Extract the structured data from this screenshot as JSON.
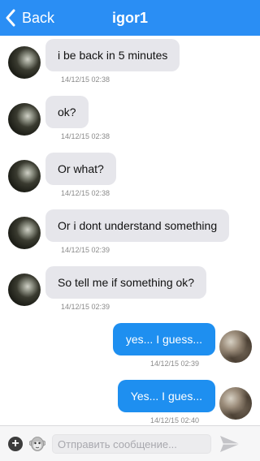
{
  "header": {
    "back_label": "Back",
    "title": "igor1"
  },
  "messages": [
    {
      "direction": "incoming",
      "text": "i be back in 5 minutes",
      "time": "14/12/15 02:38"
    },
    {
      "direction": "incoming",
      "text": "ok?",
      "time": "14/12/15 02:38"
    },
    {
      "direction": "incoming",
      "text": "Or what?",
      "time": "14/12/15 02:38"
    },
    {
      "direction": "incoming",
      "text": "Or i dont understand something",
      "time": "14/12/15 02:39"
    },
    {
      "direction": "incoming",
      "text": "So tell me if something ok?",
      "time": "14/12/15 02:39"
    },
    {
      "direction": "outgoing",
      "text": "yes... I guess...",
      "time": "14/12/15 02:39"
    },
    {
      "direction": "outgoing",
      "text": "Yes... I gues...",
      "time": "14/12/15 02:40"
    }
  ],
  "composer": {
    "placeholder": "Отправить сообщение...",
    "value": ""
  },
  "colors": {
    "nav_bar": "#2a8ef4",
    "outgoing_bubble": "#1e8ff0",
    "incoming_bubble": "#e6e6eb"
  },
  "icons": {
    "back": "chevron-left-icon",
    "add": "plus-circle-icon",
    "emoji": "monkey-emoji-icon",
    "send": "paper-plane-icon"
  }
}
